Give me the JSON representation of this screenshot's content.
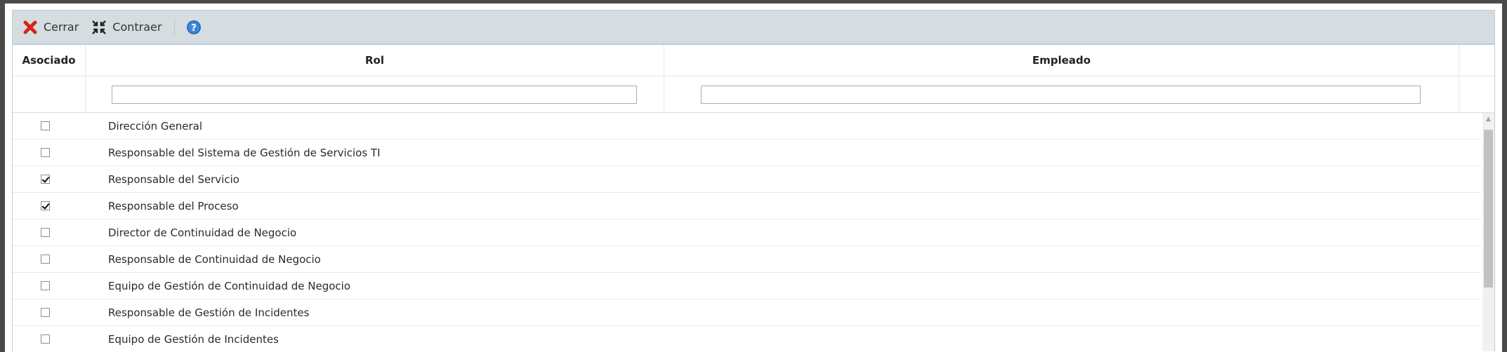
{
  "toolbar": {
    "close_label": "Cerrar",
    "collapse_label": "Contraer",
    "close_icon_color": "#d9231c",
    "help_icon_color": "#2a6ebd"
  },
  "columns": {
    "asociado": "Asociado",
    "rol": "Rol",
    "empleado": "Empleado"
  },
  "filters": {
    "rol_value": "",
    "empleado_value": ""
  },
  "rows": [
    {
      "checked": false,
      "rol": "Dirección General",
      "empleado": ""
    },
    {
      "checked": false,
      "rol": "Responsable del Sistema de Gestión de Servicios TI",
      "empleado": ""
    },
    {
      "checked": true,
      "rol": "Responsable del Servicio",
      "empleado": ""
    },
    {
      "checked": true,
      "rol": "Responsable del Proceso",
      "empleado": ""
    },
    {
      "checked": false,
      "rol": "Director de Continuidad de Negocio",
      "empleado": ""
    },
    {
      "checked": false,
      "rol": "Responsable de Continuidad de Negocio",
      "empleado": ""
    },
    {
      "checked": false,
      "rol": "Equipo de Gestión de Continuidad de Negocio",
      "empleado": ""
    },
    {
      "checked": false,
      "rol": "Responsable de Gestión de Incidentes",
      "empleado": ""
    },
    {
      "checked": false,
      "rol": "Equipo de Gestión de Incidentes",
      "empleado": ""
    }
  ]
}
